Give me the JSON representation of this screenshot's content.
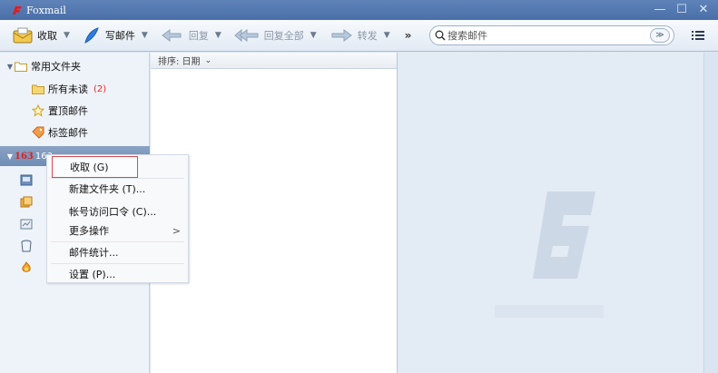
{
  "window": {
    "title": "Foxmail",
    "minimize_glyph": "—",
    "restore_glyph": "☐",
    "close_glyph": "✕"
  },
  "toolbar": {
    "receive_label": "收取",
    "compose_label": "写邮件",
    "reply_label": "回复",
    "reply_all_label": "回复全部",
    "forward_label": "转发",
    "more_label": "»",
    "dropdown_arrow": "▼",
    "search_placeholder": "搜索邮件",
    "search_dropdown_glyph": "≫"
  },
  "sidebar": {
    "common_folder_label": "常用文件夹",
    "items": [
      {
        "label": "所有未读",
        "count": "(2)"
      },
      {
        "label": "置顶邮件"
      },
      {
        "label": "标签邮件"
      }
    ],
    "account_badge": "163",
    "account_label": "163"
  },
  "list": {
    "sort_label": "排序: 日期",
    "sort_chevron": "⌄"
  },
  "context_menu": {
    "items": [
      {
        "label": "收取 (G)"
      },
      {
        "label": "新建文件夹 (T)..."
      },
      {
        "label": "帐号访问口令 (C)..."
      },
      {
        "label": "更多操作",
        "submenu": ">"
      },
      {
        "label": "邮件统计..."
      },
      {
        "label": "设置 (P)..."
      }
    ]
  },
  "colors": {
    "accent_red": "#e31c1c",
    "title_blue": "#4a6ea7",
    "unread_red": "#ee2222"
  },
  "icons": [
    "foxmail-logo-icon",
    "receive-icon",
    "compose-icon",
    "reply-icon",
    "reply-all-icon",
    "forward-icon",
    "search-icon",
    "menu-icon",
    "folder-icon",
    "star-icon",
    "tag-icon",
    "inbox-icon",
    "drafts-icon",
    "sent-icon",
    "trash-icon",
    "spam-icon",
    "foxmail-watermark-icon"
  ]
}
